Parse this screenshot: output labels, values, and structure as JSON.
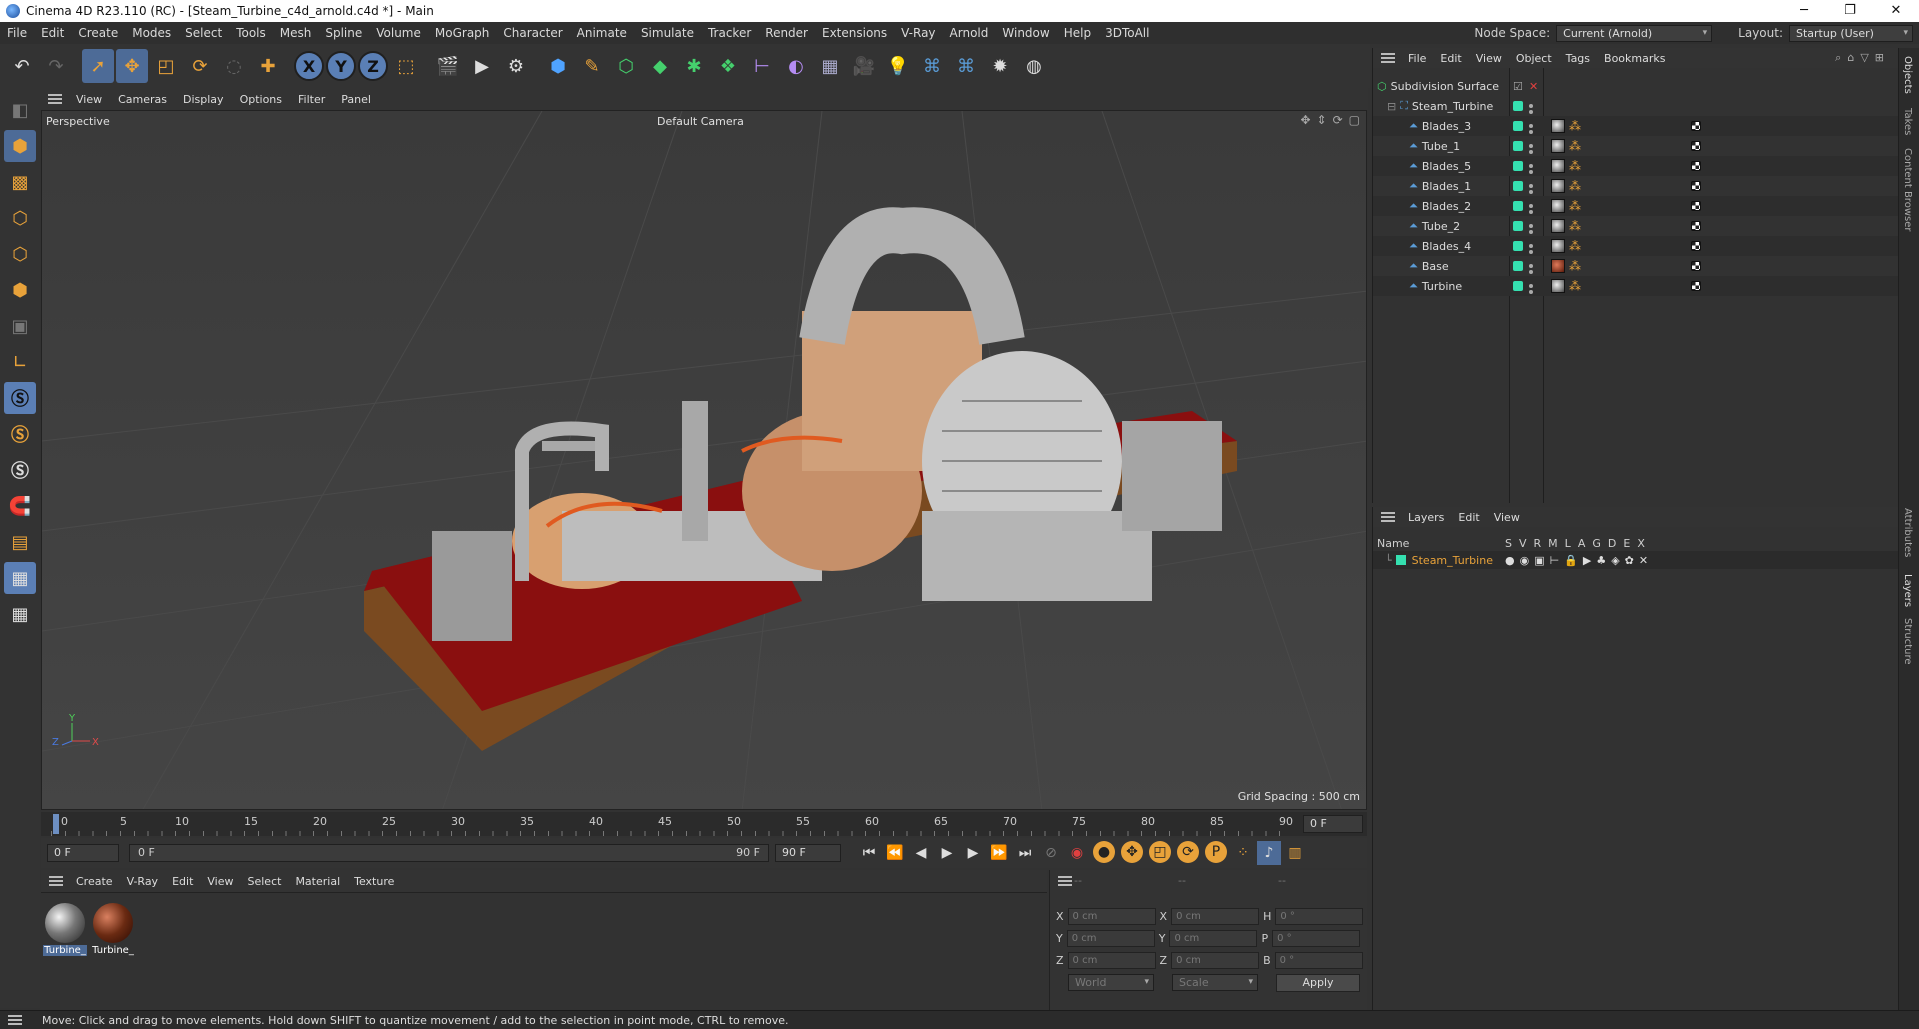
{
  "window": {
    "title": "Cinema 4D R23.110 (RC) - [Steam_Turbine_c4d_arnold.c4d *] - Main",
    "controls": [
      "─",
      "❐",
      "✕"
    ]
  },
  "menu": [
    "File",
    "Edit",
    "Create",
    "Modes",
    "Select",
    "Tools",
    "Mesh",
    "Spline",
    "Volume",
    "MoGraph",
    "Character",
    "Animate",
    "Simulate",
    "Tracker",
    "Render",
    "Extensions",
    "V-Ray",
    "Arnold",
    "Window",
    "Help",
    "3DToAll"
  ],
  "node_space": {
    "label": "Node Space:",
    "value": "Current (Arnold)"
  },
  "layout": {
    "label": "Layout:",
    "value": "Startup (User)"
  },
  "toolbar": {
    "axis_x": "X",
    "axis_y": "Y",
    "axis_z": "Z"
  },
  "viewport": {
    "menu": [
      "View",
      "Cameras",
      "Display",
      "Options",
      "Filter",
      "Panel"
    ],
    "label": "Perspective",
    "camera": "Default Camera",
    "grid_spacing": "Grid Spacing : 500 cm"
  },
  "timeline": {
    "ticks": [
      "0",
      "5",
      "10",
      "15",
      "20",
      "25",
      "30",
      "35",
      "40",
      "45",
      "50",
      "55",
      "60",
      "65",
      "70",
      "75",
      "80",
      "85",
      "90"
    ],
    "current_frame": "0 F",
    "start": "0 F",
    "range_start": "0 F",
    "range_end": "90 F",
    "end": "90 F"
  },
  "material_menu": [
    "Create",
    "V-Ray",
    "Edit",
    "View",
    "Select",
    "Material",
    "Texture"
  ],
  "materials": [
    {
      "label": "Turbine_"
    },
    {
      "label": "Turbine_"
    }
  ],
  "coords": {
    "headers": [
      "--",
      "--",
      "--"
    ],
    "rows": [
      {
        "a": "X",
        "av": "0 cm",
        "b": "X",
        "bv": "0 cm",
        "c": "H",
        "cv": "0 °"
      },
      {
        "a": "Y",
        "av": "0 cm",
        "b": "Y",
        "bv": "0 cm",
        "c": "P",
        "cv": "0 °"
      },
      {
        "a": "Z",
        "av": "0 cm",
        "b": "Z",
        "bv": "0 cm",
        "c": "B",
        "cv": "0 °"
      }
    ],
    "world": "World",
    "scale": "Scale",
    "apply": "Apply"
  },
  "status": "Move: Click and drag to move elements. Hold down SHIFT to quantize movement / add to the selection in point mode, CTRL to remove.",
  "object_manager": {
    "menu": [
      "File",
      "Edit",
      "View",
      "Object",
      "Tags",
      "Bookmarks"
    ],
    "objects": [
      {
        "name": "Subdivision Surface",
        "depth": 0
      },
      {
        "name": "Steam_Turbine",
        "depth": 1
      },
      {
        "name": "Blades_3",
        "depth": 2
      },
      {
        "name": "Tube_1",
        "depth": 2
      },
      {
        "name": "Blades_5",
        "depth": 2
      },
      {
        "name": "Blades_1",
        "depth": 2
      },
      {
        "name": "Blades_2",
        "depth": 2
      },
      {
        "name": "Tube_2",
        "depth": 2
      },
      {
        "name": "Blades_4",
        "depth": 2
      },
      {
        "name": "Base",
        "depth": 2
      },
      {
        "name": "Turbine",
        "depth": 2
      }
    ]
  },
  "layers": {
    "menu": [
      "Layers",
      "Edit",
      "View"
    ],
    "header_name": "Name",
    "cols": [
      "S",
      "V",
      "R",
      "M",
      "L",
      "A",
      "G",
      "D",
      "E",
      "X"
    ],
    "items": [
      {
        "name": "Steam_Turbine"
      }
    ]
  },
  "side_tabs": [
    "Objects",
    "Takes",
    "Content Browser",
    "Attributes",
    "Layers",
    "Structure"
  ],
  "colors": {
    "accent": "#4d6b97",
    "layer": "#35e0b0",
    "orange": "#e8a23a"
  }
}
